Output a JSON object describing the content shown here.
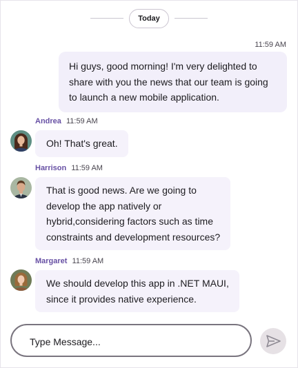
{
  "separator": {
    "label": "Today"
  },
  "outgoing": {
    "time": "11:59 AM",
    "lines": [
      "Hi guys, good morning! I'm very delighted to",
      "share with you the news that our team is going",
      "to launch a new mobile application."
    ]
  },
  "messages": [
    {
      "author": "Andrea",
      "time": "11:59 AM",
      "avatar": "woman-avatar",
      "lines": [
        "Oh! That's great."
      ]
    },
    {
      "author": "Harrison",
      "time": "11:59 AM",
      "avatar": "man-avatar",
      "lines": [
        "That is good news. Are we going to",
        "develop the app natively or",
        "hybrid,considering factors such as time",
        "constraints and development resources?"
      ]
    },
    {
      "author": "Margaret",
      "time": "11:59 AM",
      "avatar": "woman-avatar",
      "lines": [
        "We should develop this app in .NET MAUI,",
        "since it provides native experience."
      ]
    }
  ],
  "composer": {
    "placeholder": "Type Message...",
    "send_icon": "send-icon"
  },
  "colors": {
    "author_name": "#6750a4",
    "bubble": "#f2effa",
    "composer_border": "#79747e",
    "send_button": "#e6e1e5"
  }
}
